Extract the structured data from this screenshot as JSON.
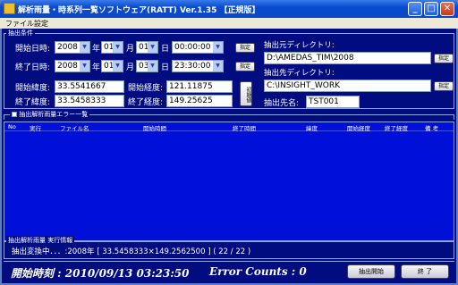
{
  "window": {
    "title": "解析雨量・時系列一覧ソフトウェア(RATT) Ver.1.35 【正規版】",
    "min": "_",
    "max": "□",
    "close": "✕"
  },
  "menu": {
    "file": "ファイル",
    "settings": "設定"
  },
  "extract": {
    "legend": "抽出条件",
    "start_label": "開始日時:",
    "end_label": "終了日時:",
    "start": {
      "year": "2008",
      "month": "01",
      "day": "01",
      "time": "00:00:00"
    },
    "end": {
      "year": "2008",
      "month": "01",
      "day": "03",
      "time": "23:30:00"
    },
    "year_unit": "年",
    "month_unit": "月",
    "day_unit": "日",
    "specify": "指定",
    "lat_start_label": "開始緯度:",
    "lat_end_label": "終了緯度:",
    "lon_start_label": "開始経度:",
    "lon_end_label": "終了経度:",
    "lat_start": "33.5541667",
    "lat_end": "33.5458333",
    "lon_start": "121.11875",
    "lon_end": "149.25625",
    "init_button": "初期値",
    "src_label": "抽出元ディレクトリ:",
    "src_value": "D:\\AMEDAS_TIM\\2008",
    "dst_label": "抽出先ディレクトリ:",
    "dst_value": "C:\\INSIGHT_WORK",
    "name_label": "抽出先名:",
    "name_value": "TST001"
  },
  "error_list": {
    "legend": "抽出解析雨量エラー一覧",
    "columns": [
      "No",
      "実行",
      "ファイル名",
      "開始時間",
      "終了時間",
      "緯度",
      "開始経度",
      "終了経度",
      "備 考"
    ]
  },
  "exec_info": {
    "legend": "抽出解析雨量 実行情報",
    "message": "抽出変換中．．．:2008年 [ 33.5458333×149.2562500 ] ( 22 / 22 )"
  },
  "status": {
    "start_time": "開始時刻 : 2010/09/13 03:23:50",
    "error_counts": "Error Counts : 0",
    "start_button": "抽出開始",
    "exit_button": "終 了"
  }
}
